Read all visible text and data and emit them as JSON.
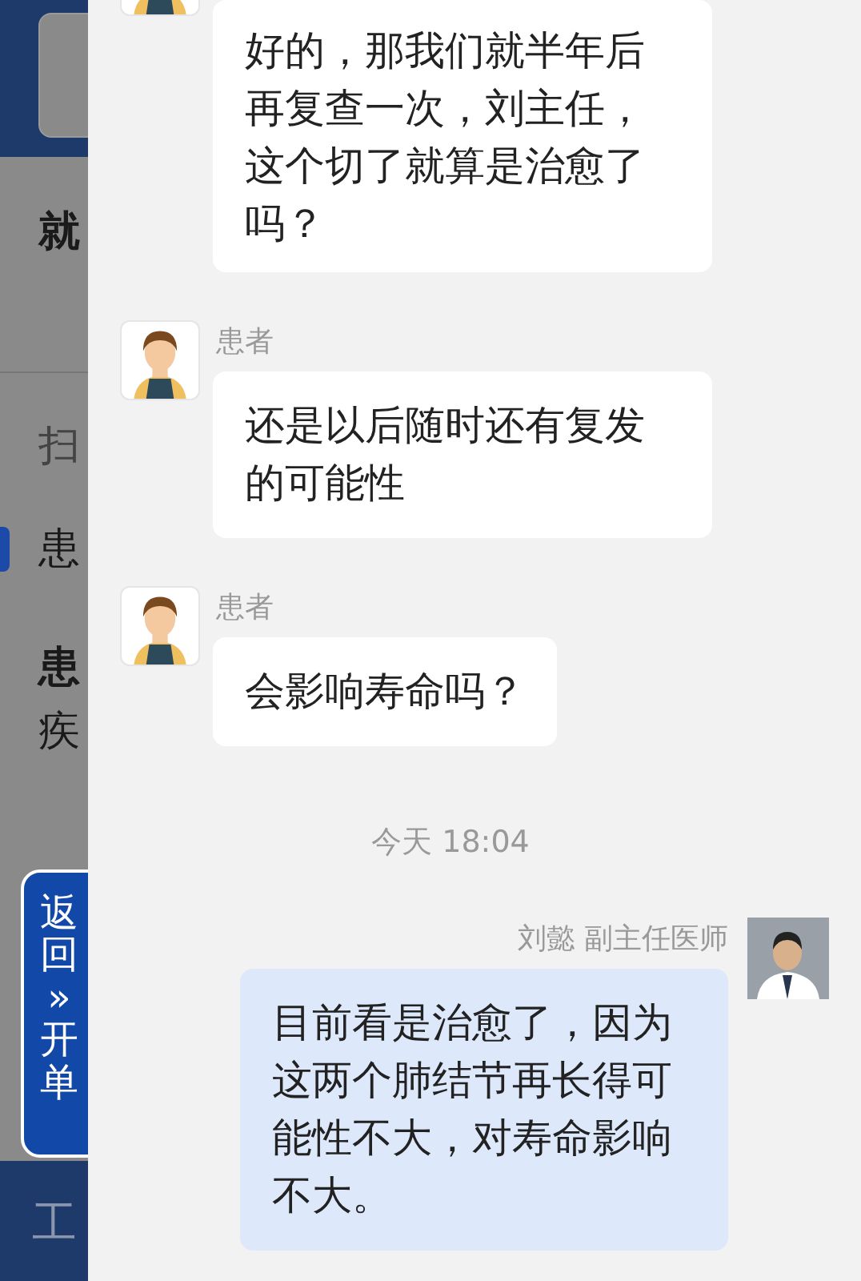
{
  "background_page": {
    "items": [
      {
        "kind": "heading",
        "text": "就"
      },
      {
        "kind": "divider_text",
        "text": "扫"
      },
      {
        "kind": "marked",
        "text": "患"
      },
      {
        "kind": "heading",
        "text": "患"
      },
      {
        "kind": "plain",
        "text": "疾"
      }
    ],
    "footer": {
      "text": "工"
    }
  },
  "side_tab": {
    "label": "返回»开单"
  },
  "messages": [
    {
      "kind": "patient",
      "text": "好的，那我们就半年后再复查一次，刘主任，这个切了就算是治愈了吗？"
    },
    {
      "kind": "patient",
      "sender": "患者",
      "text": "还是以后随时还有复发的可能性"
    },
    {
      "kind": "patient",
      "sender": "患者",
      "text": "会影响寿命吗？"
    },
    {
      "kind": "time",
      "text": "今天 18:04"
    },
    {
      "kind": "doctor",
      "sender": "刘懿 副主任医师",
      "text": "目前看是治愈了，因为这两个肺结节再长得可能性不大，对寿命影响不大。"
    }
  ]
}
